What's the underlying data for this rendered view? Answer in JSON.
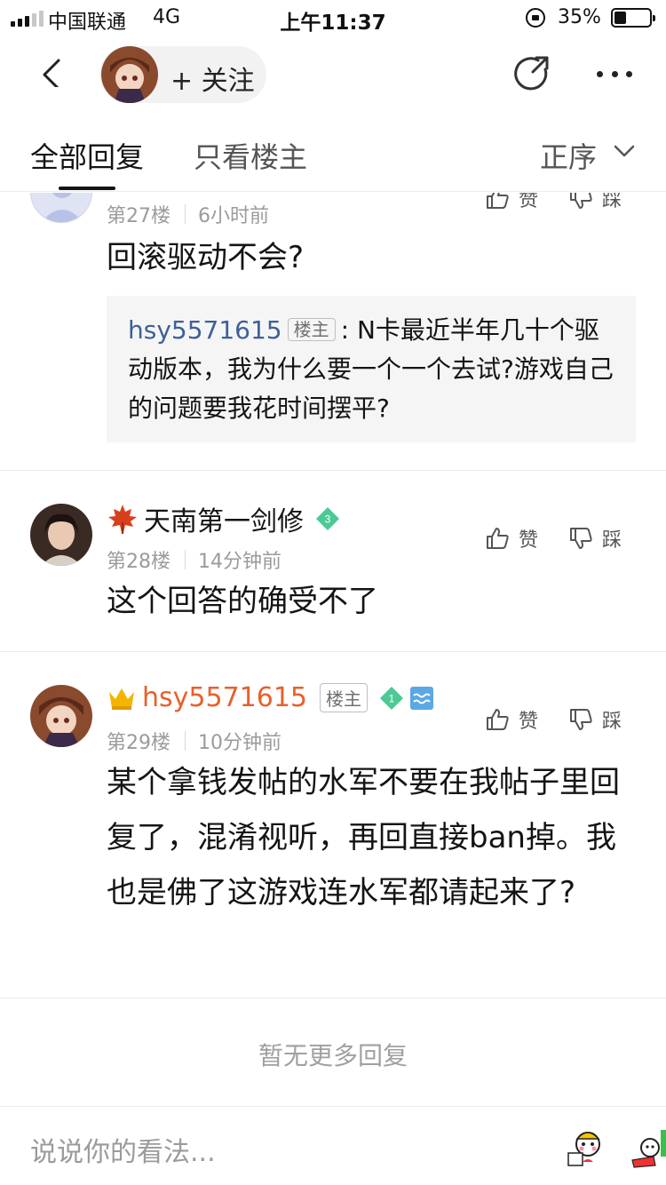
{
  "status_bar": {
    "carrier": "中国联通",
    "network": "4G",
    "time": "上午11:37",
    "battery_percent": "35%",
    "battery_level": 0.35
  },
  "nav": {
    "follow_label": "+ 关注",
    "icons": {
      "back": "back-chevron-icon",
      "share": "share-icon",
      "more": "more-dots-icon"
    }
  },
  "tabs": {
    "all": "全部回复",
    "op_only": "只看楼主",
    "sort": "正序"
  },
  "posts": [
    {
      "floor": "第27楼",
      "time": "6小时前",
      "text": "回滚驱动不会?",
      "like": "赞",
      "dislike": "踩",
      "quote": {
        "user": "hsy5571615",
        "badge": "楼主",
        "colon": ":",
        "text": "N卡最近半年几十个驱动版本，我为什么要一个一个去试?游戏自己的问题要我花时间摆平?"
      }
    },
    {
      "username": "天南第一剑修",
      "level": "3",
      "floor": "第28楼",
      "time": "14分钟前",
      "text": "这个回答的确受不了",
      "like": "赞",
      "dislike": "踩"
    },
    {
      "username": "hsy5571615",
      "badge": "楼主",
      "level": "1",
      "floor": "第29楼",
      "time": "10分钟前",
      "text": "某个拿钱发帖的水军不要在我帖子里回复了，混淆视听，再回直接ban掉。我也是佛了这游戏连水军都请起来了?",
      "like": "赞",
      "dislike": "踩"
    }
  ],
  "no_more": "暂无更多回复",
  "bottom": {
    "placeholder": "说说你的看法..."
  },
  "colors": {
    "op_name": "#e8602c",
    "quote_user": "#3e5f9a",
    "gem": "#4cc995",
    "meta": "#9b9b9b"
  }
}
